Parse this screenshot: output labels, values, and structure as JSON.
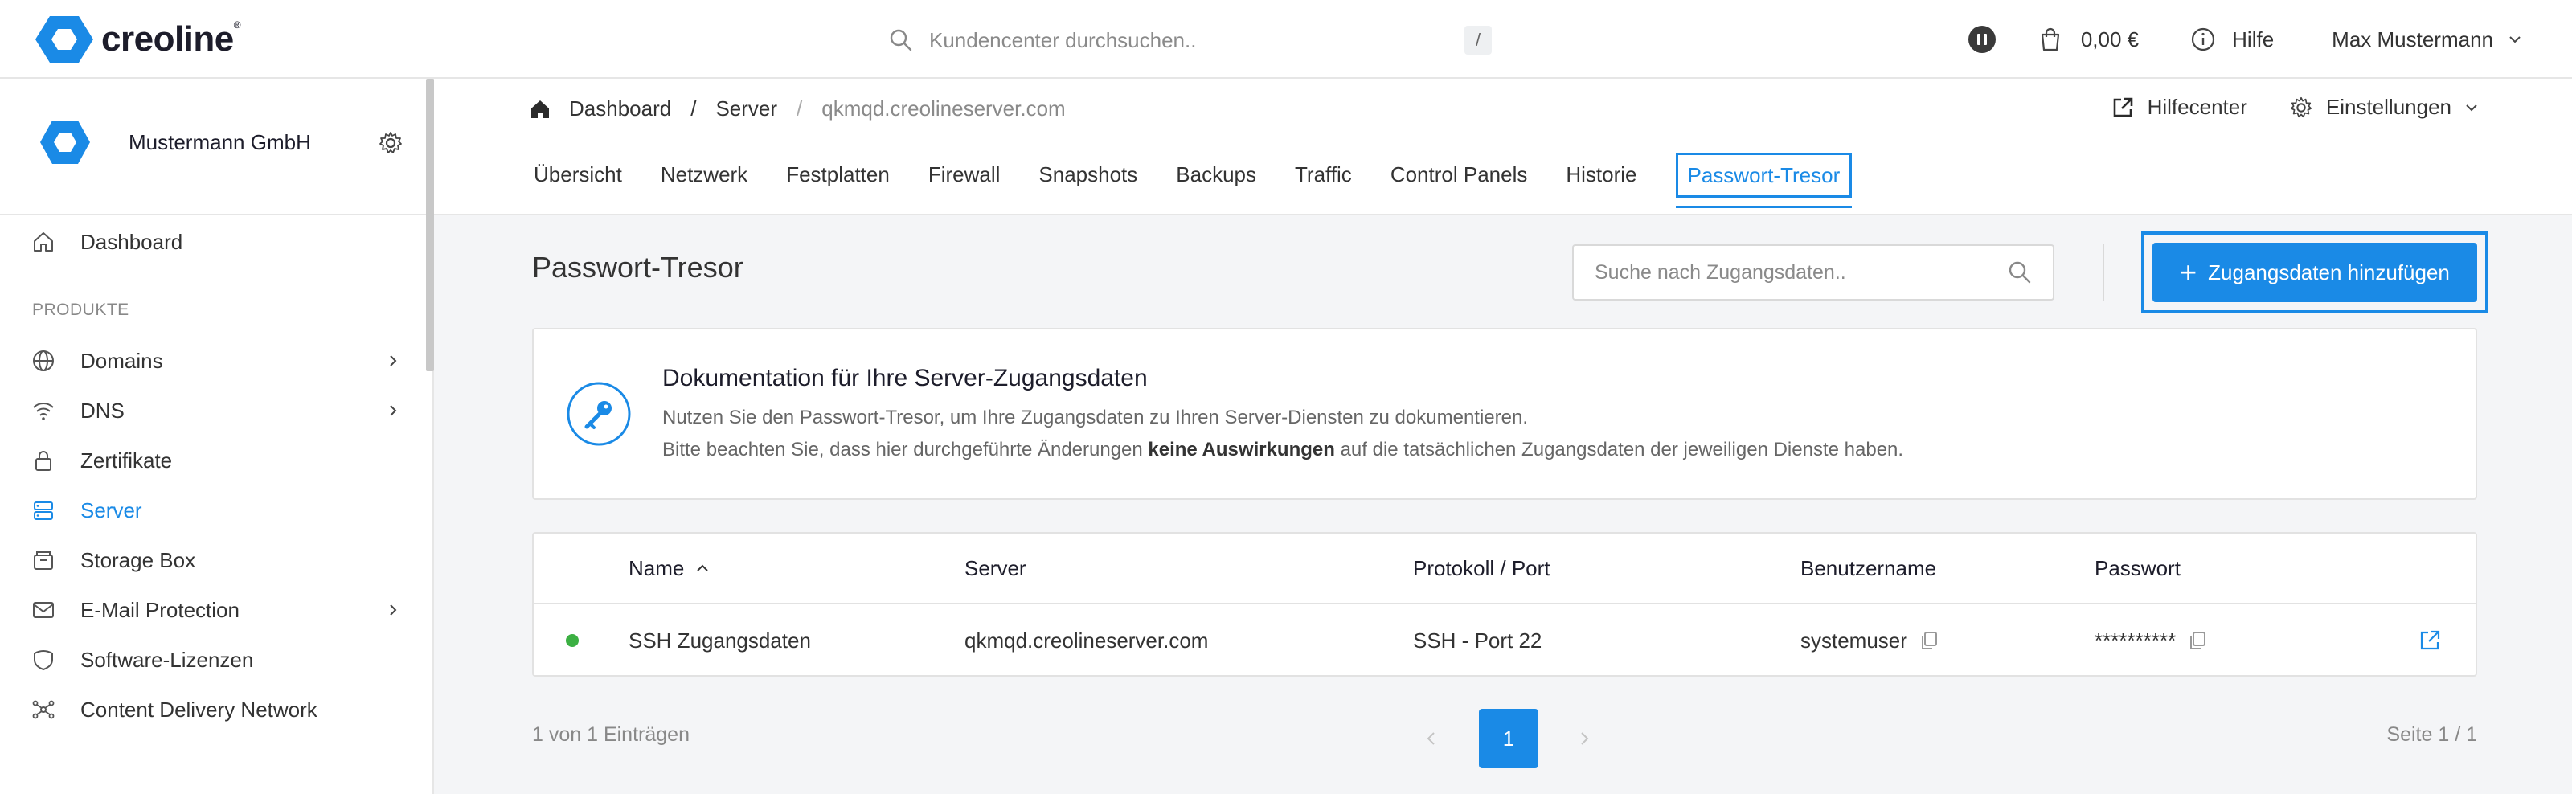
{
  "brand": {
    "name": "creoline",
    "trademark": "®"
  },
  "global_search": {
    "placeholder": "Kundencenter durchsuchen..",
    "shortcut": "/"
  },
  "topbar": {
    "cart_amount": "0,00 €",
    "help_label": "Hilfe",
    "user_name": "Max Mustermann"
  },
  "sidebar": {
    "company_name": "Mustermann GmbH",
    "dashboard_label": "Dashboard",
    "section_label": "PRODUKTE",
    "items": [
      {
        "label": "Domains",
        "icon": "globe-icon",
        "has_chevron": true,
        "active": false
      },
      {
        "label": "DNS",
        "icon": "wifi-icon",
        "has_chevron": true,
        "active": false
      },
      {
        "label": "Zertifikate",
        "icon": "lock-icon",
        "has_chevron": false,
        "active": false
      },
      {
        "label": "Server",
        "icon": "server-icon",
        "has_chevron": false,
        "active": true
      },
      {
        "label": "Storage Box",
        "icon": "box-icon",
        "has_chevron": false,
        "active": false
      },
      {
        "label": "E-Mail Protection",
        "icon": "mail-icon",
        "has_chevron": true,
        "active": false
      },
      {
        "label": "Software-Lizenzen",
        "icon": "badge-icon",
        "has_chevron": false,
        "active": false
      },
      {
        "label": "Content Delivery Network",
        "icon": "network-icon",
        "has_chevron": false,
        "active": false
      }
    ]
  },
  "breadcrumb": {
    "home": "Dashboard",
    "server": "Server",
    "current": "qkmqd.creolineserver.com"
  },
  "header_actions": {
    "help_center": "Hilfecenter",
    "settings": "Einstellungen"
  },
  "tabs": [
    "Übersicht",
    "Netzwerk",
    "Festplatten",
    "Firewall",
    "Snapshots",
    "Backups",
    "Traffic",
    "Control Panels",
    "Historie",
    "Passwort-Tresor"
  ],
  "active_tab": "Passwort-Tresor",
  "page": {
    "title": "Passwort-Tresor",
    "search_placeholder": "Suche nach Zugangsdaten..",
    "add_button": "Zugangsdaten hinzufügen"
  },
  "info": {
    "title": "Dokumentation für Ihre Server-Zugangsdaten",
    "line1": "Nutzen Sie den Passwort-Tresor, um Ihre Zugangsdaten zu Ihren Server-Diensten zu dokumentieren.",
    "line2_pre": "Bitte beachten Sie, dass hier durchgeführte Änderungen ",
    "line2_bold": "keine Auswirkungen",
    "line2_post": " auf die tatsächlichen Zugangsdaten der jeweiligen Dienste haben."
  },
  "table": {
    "headers": {
      "name": "Name",
      "server": "Server",
      "protocol": "Protokoll / Port",
      "username": "Benutzername",
      "password": "Passwort"
    },
    "rows": [
      {
        "status_color": "#3cb043",
        "name": "SSH Zugangsdaten",
        "server": "qkmqd.creolineserver.com",
        "protocol": "SSH - Port 22",
        "username": "systemuser",
        "password": "**********"
      }
    ]
  },
  "pagination": {
    "summary": "1 von 1 Einträgen",
    "current_page": "1",
    "page_info": "Seite 1 / 1"
  },
  "colors": {
    "accent": "#1a8ae6",
    "status_ok": "#3cb043",
    "background": "#f4f5f7"
  }
}
